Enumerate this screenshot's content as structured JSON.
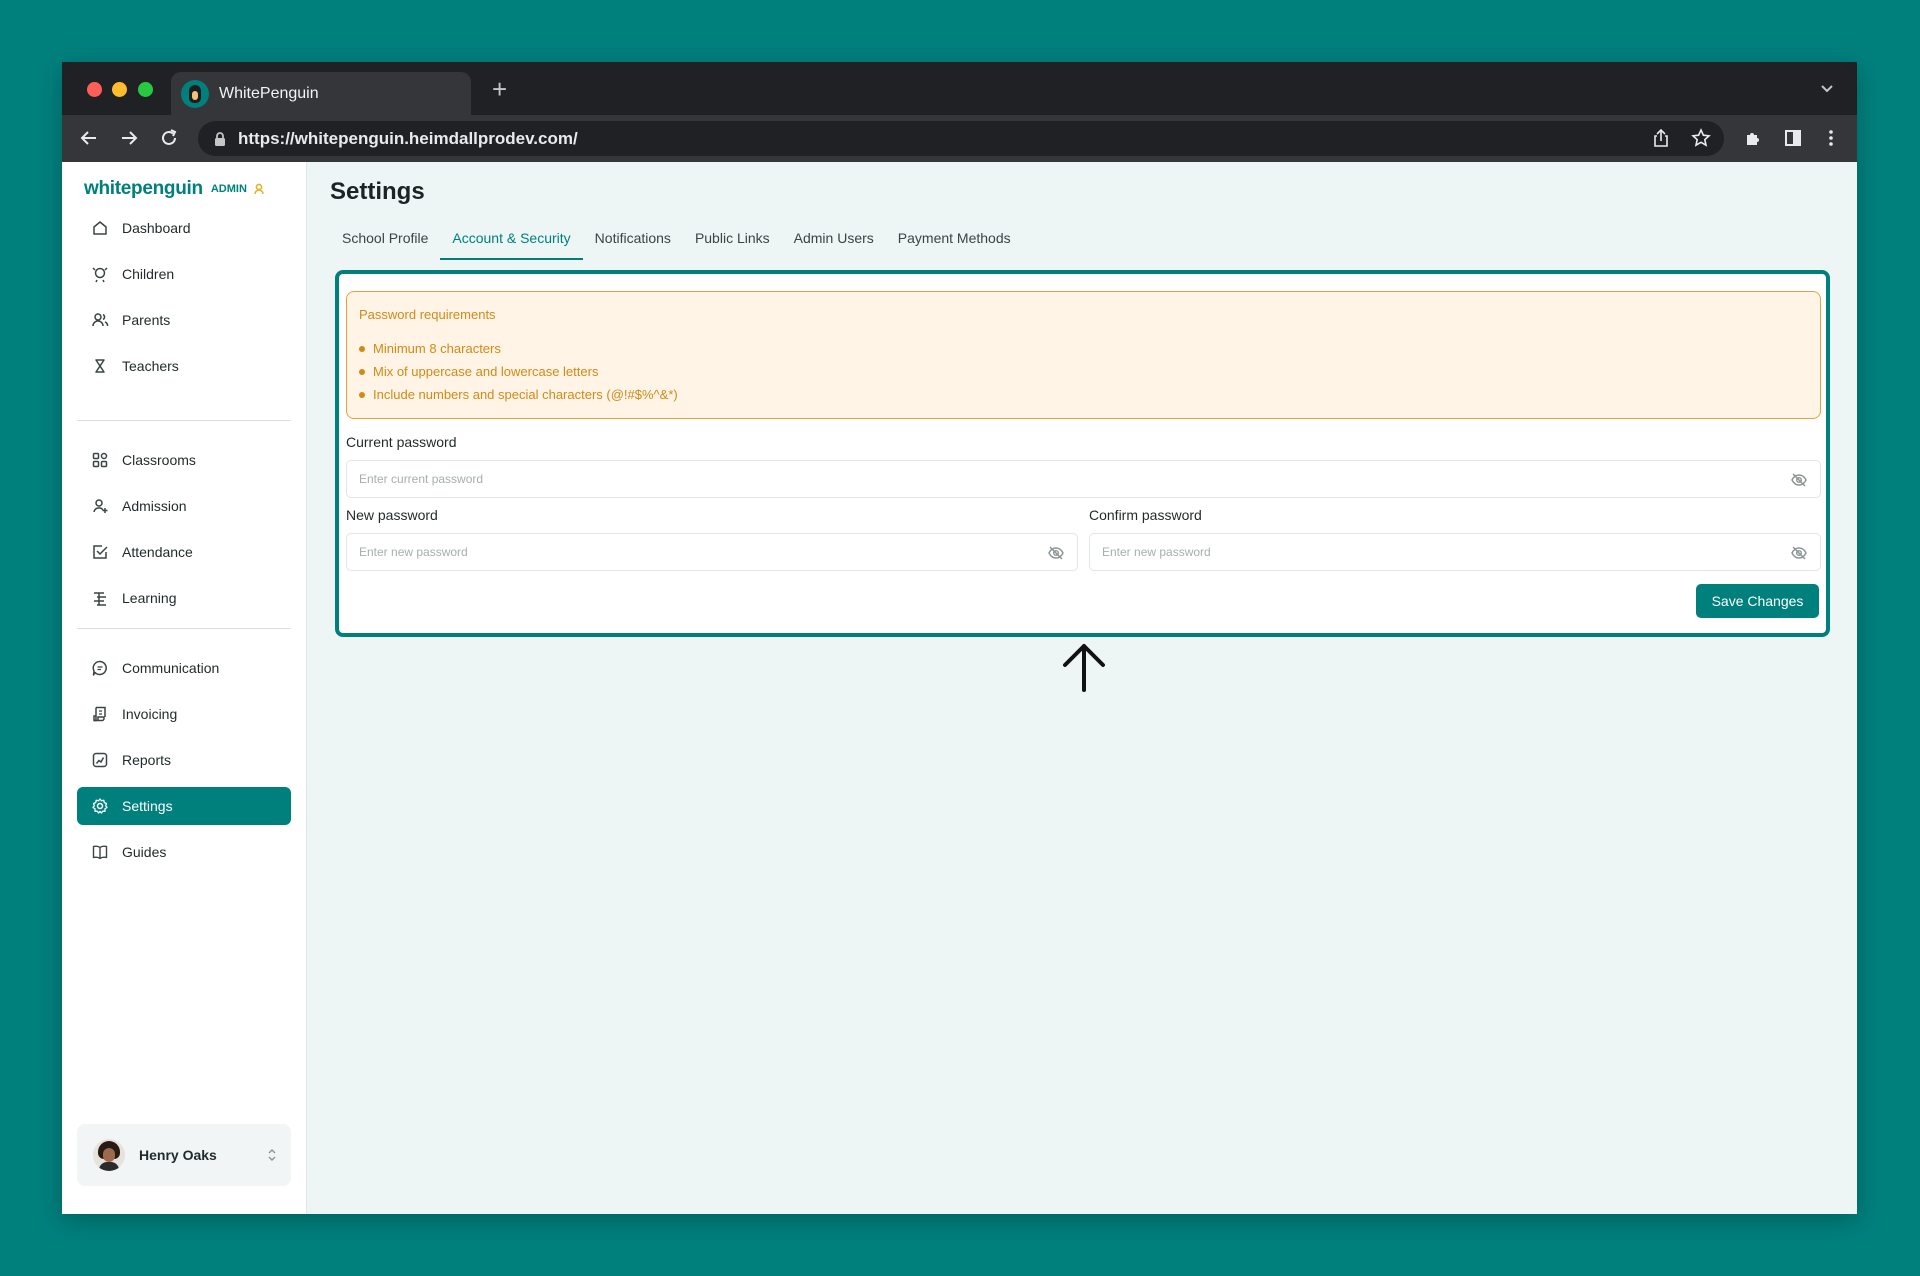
{
  "browser": {
    "tab_title": "WhitePenguin",
    "url": "https://whitepenguin.heimdallprodev.com/"
  },
  "brand": {
    "logo_text": "whitepenguin",
    "admin_label": "ADMIN",
    "accent_color": "#00807d"
  },
  "sidebar": {
    "items": [
      {
        "label": "Dashboard",
        "icon": "home-icon"
      },
      {
        "label": "Children",
        "icon": "child-icon"
      },
      {
        "label": "Parents",
        "icon": "users-icon"
      },
      {
        "label": "Teachers",
        "icon": "teacher-icon"
      },
      {
        "label": "Classrooms",
        "icon": "grid-icon"
      },
      {
        "label": "Admission",
        "icon": "user-plus-icon"
      },
      {
        "label": "Attendance",
        "icon": "check-square-icon"
      },
      {
        "label": "Learning",
        "icon": "book-list-icon"
      },
      {
        "label": "Communication",
        "icon": "chat-icon"
      },
      {
        "label": "Invoicing",
        "icon": "invoice-icon"
      },
      {
        "label": "Reports",
        "icon": "chart-icon"
      },
      {
        "label": "Settings",
        "icon": "gear-icon",
        "active": true
      },
      {
        "label": "Guides",
        "icon": "book-open-icon"
      }
    ],
    "user": {
      "name": "Henry Oaks"
    }
  },
  "main": {
    "title": "Settings",
    "tabs": [
      {
        "label": "School Profile"
      },
      {
        "label": "Account & Security",
        "active": true
      },
      {
        "label": "Notifications"
      },
      {
        "label": "Public Links"
      },
      {
        "label": "Admin Users"
      },
      {
        "label": "Payment Methods"
      }
    ],
    "requirements": {
      "title": "Password requirements",
      "items": [
        "Minimum 8 characters",
        "Mix of uppercase and lowercase letters",
        "Include numbers and special characters (@!#$%^&*)"
      ]
    },
    "form": {
      "current_label": "Current password",
      "current_placeholder": "Enter current password",
      "new_label": "New password",
      "new_placeholder": "Enter new password",
      "confirm_label": "Confirm password",
      "confirm_placeholder": "Enter new password",
      "save_label": "Save Changes"
    }
  }
}
